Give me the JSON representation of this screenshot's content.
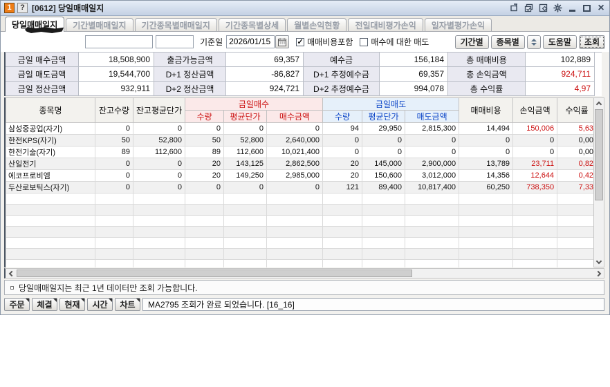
{
  "titlebar": {
    "badge": "1",
    "help_badge": "?",
    "title": "[0612] 당일매매일지",
    "window_controls": [
      "pin-window",
      "clone-window",
      "capture-window",
      "settings",
      "minimize",
      "maximize",
      "close"
    ]
  },
  "tabs": [
    {
      "label": "당일매매일지",
      "active": true
    },
    {
      "label": "기간별매매일지",
      "active": false
    },
    {
      "label": "기간종목별매매일지",
      "active": false
    },
    {
      "label": "기간종목별상세",
      "active": false
    },
    {
      "label": "월별손익현황",
      "active": false
    },
    {
      "label": "전일대비평가손익",
      "active": false
    },
    {
      "label": "일자별평가손익",
      "active": false
    }
  ],
  "toolbar": {
    "account_value": "",
    "password_value": "",
    "base_date_label": "기준일",
    "base_date": "2026/01/15",
    "calendar_icon": "calendar",
    "include_fee_label": "매매비용포함",
    "include_fee_checked": true,
    "sell_of_buy_label": "매수에 대한 매도",
    "sell_of_buy_checked": false,
    "period_button": "기간별",
    "symbol_button": "종목별",
    "help_button": "도움말",
    "query_button": "조회"
  },
  "summary": {
    "rows": [
      [
        {
          "label": "금일 매수금액",
          "value": "18,508,900",
          "red": false
        },
        {
          "label": "출금가능금액",
          "value": "69,357",
          "red": false
        },
        {
          "label": "예수금",
          "value": "156,184",
          "red": false
        },
        {
          "label": "총 매매비용",
          "value": "102,889",
          "red": false
        }
      ],
      [
        {
          "label": "금일 매도금액",
          "value": "19,544,700",
          "red": false
        },
        {
          "label": "D+1 정산금액",
          "value": "-86,827",
          "red": false
        },
        {
          "label": "D+1 추정예수금",
          "value": "69,357",
          "red": false
        },
        {
          "label": "총 손익금액",
          "value": "924,711",
          "red": true
        }
      ],
      [
        {
          "label": "금일 정산금액",
          "value": "932,911",
          "red": false
        },
        {
          "label": "D+2 정산금액",
          "value": "924,721",
          "red": false
        },
        {
          "label": "D+2 추정예수금",
          "value": "994,078",
          "red": false
        },
        {
          "label": "총 수익률",
          "value": "4,97",
          "red": true
        }
      ]
    ]
  },
  "grid": {
    "headers": {
      "stock": "종목명",
      "balance_qty": "잔고수량",
      "balance_avg": "잔고평균단가",
      "buy_group": "금일매수",
      "sell_group": "금일매도",
      "qty": "수량",
      "avg": "평균단가",
      "buy_amt": "매수금액",
      "sell_amt": "매도금액",
      "fee": "매매비용",
      "pl": "손익금액",
      "rate": "수익률"
    },
    "rows": [
      {
        "name": "삼성중공업(자기)",
        "cells": [
          "0",
          "0",
          "0",
          "0",
          "0",
          "94",
          "29,950",
          "2,815,300",
          "14,494",
          "150,006",
          "5,63"
        ],
        "red_cells": [
          9,
          10
        ]
      },
      {
        "name": "한전KPS(자기)",
        "cells": [
          "50",
          "52,800",
          "50",
          "52,800",
          "2,640,000",
          "0",
          "0",
          "0",
          "0",
          "0",
          "0,00"
        ],
        "red_cells": []
      },
      {
        "name": "한전기술(자기)",
        "cells": [
          "89",
          "112,600",
          "89",
          "112,600",
          "10,021,400",
          "0",
          "0",
          "0",
          "0",
          "0",
          "0,00"
        ],
        "red_cells": []
      },
      {
        "name": "산일전기",
        "cells": [
          "0",
          "0",
          "20",
          "143,125",
          "2,862,500",
          "20",
          "145,000",
          "2,900,000",
          "13,789",
          "23,711",
          "0,82"
        ],
        "red_cells": [
          9,
          10
        ]
      },
      {
        "name": "에코프로비엠",
        "cells": [
          "0",
          "0",
          "20",
          "149,250",
          "2,985,000",
          "20",
          "150,600",
          "3,012,000",
          "14,356",
          "12,644",
          "0,42"
        ],
        "red_cells": [
          9,
          10
        ]
      },
      {
        "name": "두산로보틱스(자기)",
        "cells": [
          "0",
          "0",
          "0",
          "0",
          "0",
          "121",
          "89,400",
          "10,817,400",
          "60,250",
          "738,350",
          "7,33"
        ],
        "red_cells": [
          9,
          10
        ]
      }
    ],
    "empty_rows": 8
  },
  "notice": "당일매매일지는 최근 1년 데이터만 조회 가능합니다.",
  "statusbar": {
    "buttons": [
      "주문",
      "체결",
      "현재",
      "시간",
      "차트"
    ],
    "message": "MA2795 조회가 완료 되었습니다. [16_16]"
  },
  "colors": {
    "buy_red": "#cc1414",
    "sell_blue": "#1048c8",
    "value_red": "#cc1212",
    "badge_orange": "#ee7d17",
    "titlebar_blue": "#c4d1e4"
  }
}
